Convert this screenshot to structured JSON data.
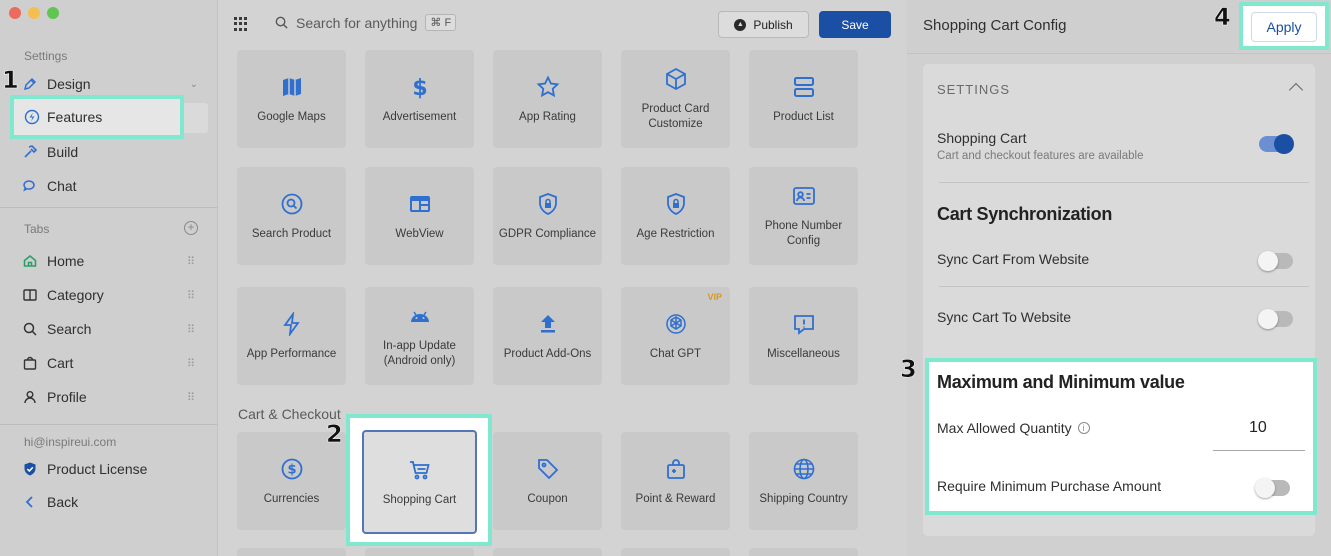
{
  "sidebar": {
    "settings_header": "Settings",
    "items": [
      {
        "label": "Design",
        "icon": "pen-icon"
      },
      {
        "label": "Features",
        "icon": "lightning-icon"
      },
      {
        "label": "Build",
        "icon": "hammer-icon"
      },
      {
        "label": "Chat",
        "icon": "chat-icon"
      }
    ],
    "tabs_header": "Tabs",
    "tabs": [
      {
        "label": "Home",
        "icon": "home-icon"
      },
      {
        "label": "Category",
        "icon": "book-icon"
      },
      {
        "label": "Search",
        "icon": "search-icon"
      },
      {
        "label": "Cart",
        "icon": "bag-icon"
      },
      {
        "label": "Profile",
        "icon": "user-icon"
      }
    ],
    "email": "hi@inspireui.com",
    "license": "Product License",
    "back": "Back"
  },
  "toolbar": {
    "search_placeholder": "Search for anything",
    "shortcut": "⌘ F",
    "publish_label": "Publish",
    "save_label": "Save"
  },
  "features": [
    {
      "label": "Google Maps",
      "icon": "map-icon"
    },
    {
      "label": "Advertisement",
      "icon": "dollar-icon"
    },
    {
      "label": "App Rating",
      "icon": "star-icon"
    },
    {
      "label": "Product Card\nCustomize",
      "icon": "box-icon"
    },
    {
      "label": "Product List",
      "icon": "list-icon"
    },
    {
      "label": "Search Product",
      "icon": "search-circle-icon"
    },
    {
      "label": "WebView",
      "icon": "browser-icon"
    },
    {
      "label": "GDPR Compliance",
      "icon": "shield-lock-icon"
    },
    {
      "label": "Age Restriction",
      "icon": "shield-lock-icon"
    },
    {
      "label": "Phone Number\nConfig",
      "icon": "contact-card-icon"
    },
    {
      "label": "App Performance",
      "icon": "lightning-icon"
    },
    {
      "label": "In-app Update\n(Android only)",
      "icon": "android-icon"
    },
    {
      "label": "Product Add-Ons",
      "icon": "upload-icon"
    },
    {
      "label": "Chat GPT",
      "icon": "openai-icon",
      "badge": "VIP"
    },
    {
      "label": "Miscellaneous",
      "icon": "alert-bubble-icon"
    }
  ],
  "cart_section_label": "Cart & Checkout",
  "cart_features": [
    {
      "label": "Currencies",
      "icon": "dollar-circle-icon"
    },
    {
      "label": "Shopping Cart",
      "icon": "cart-icon"
    },
    {
      "label": "Coupon",
      "icon": "tag-icon"
    },
    {
      "label": "Point & Reward",
      "icon": "gift-bag-icon"
    },
    {
      "label": "Shipping Country",
      "icon": "globe-icon"
    }
  ],
  "config": {
    "title": "Shopping Cart Config",
    "apply_label": "Apply",
    "settings_header": "SETTINGS",
    "shopping_cart_title": "Shopping Cart",
    "shopping_cart_desc": "Cart and checkout features are available",
    "shopping_cart_enabled": true,
    "sync_heading": "Cart Synchronization",
    "sync_from_label": "Sync Cart From Website",
    "sync_from_enabled": false,
    "sync_to_label": "Sync Cart To Website",
    "sync_to_enabled": false,
    "minmax_heading": "Maximum and Minimum value",
    "max_qty_label": "Max Allowed Quantity",
    "max_qty_value": "10",
    "min_purchase_label": "Require Minimum Purchase Amount",
    "min_purchase_enabled": false
  },
  "steps": [
    "1",
    "2",
    "3",
    "4"
  ],
  "colors": {
    "accent": "#1a4fa3",
    "highlight": "#7fe8cf",
    "icon_blue": "#2f6fd0",
    "vip": "#d49a25"
  }
}
